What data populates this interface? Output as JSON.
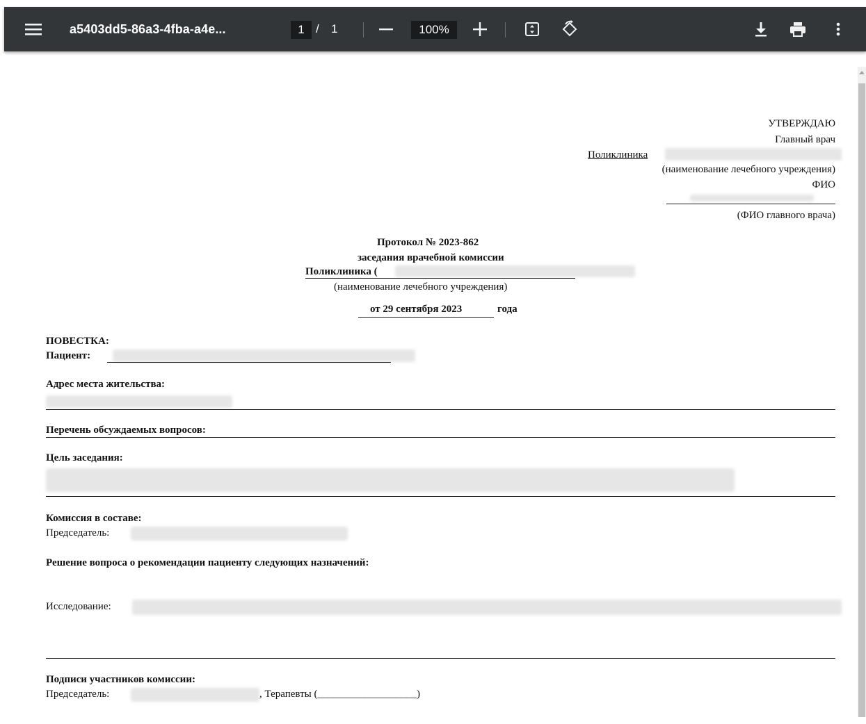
{
  "toolbar": {
    "title": "a5403dd5-86a3-4fba-a4e...",
    "page_current": "1",
    "page_separator": "/",
    "page_total": "1",
    "zoom": "100%"
  },
  "document": {
    "approve": {
      "title": "УТВЕРЖДАЮ",
      "position": "Главный врач",
      "org_prefix": "Поликлиника",
      "org_caption": "(наименование лечебного учреждения)",
      "fio_label": "ФИО",
      "fio_caption": "(ФИО главного врача)"
    },
    "protocol": {
      "title": "Протокол № 2023-862",
      "subtitle": "заседания врачебной комиссии",
      "org_line": "Поликлиника (",
      "org_caption": "(наименование лечебного учреждения)",
      "date": "от 29 сентября 2023",
      "year_suffix": "года"
    },
    "agenda_label": "ПОВЕСТКА:",
    "patient_label": "Пациент:",
    "address_label": "Адрес места жительства:",
    "questions_label": "Перечень обсуждаемых вопросов:",
    "purpose_label": "Цель заседания:",
    "commission_label": "Комиссия в составе:",
    "chairman_label": "Председатель:",
    "decision_label": "Решение вопроса о рекомендации пациенту следующих назначений:",
    "research_label": "Исследование:",
    "signatures_label": "Подписи участников комиссии:",
    "signatures_chairman_label": "Председатель:",
    "signatures_therapists": ", Терапевты (___________________)"
  }
}
